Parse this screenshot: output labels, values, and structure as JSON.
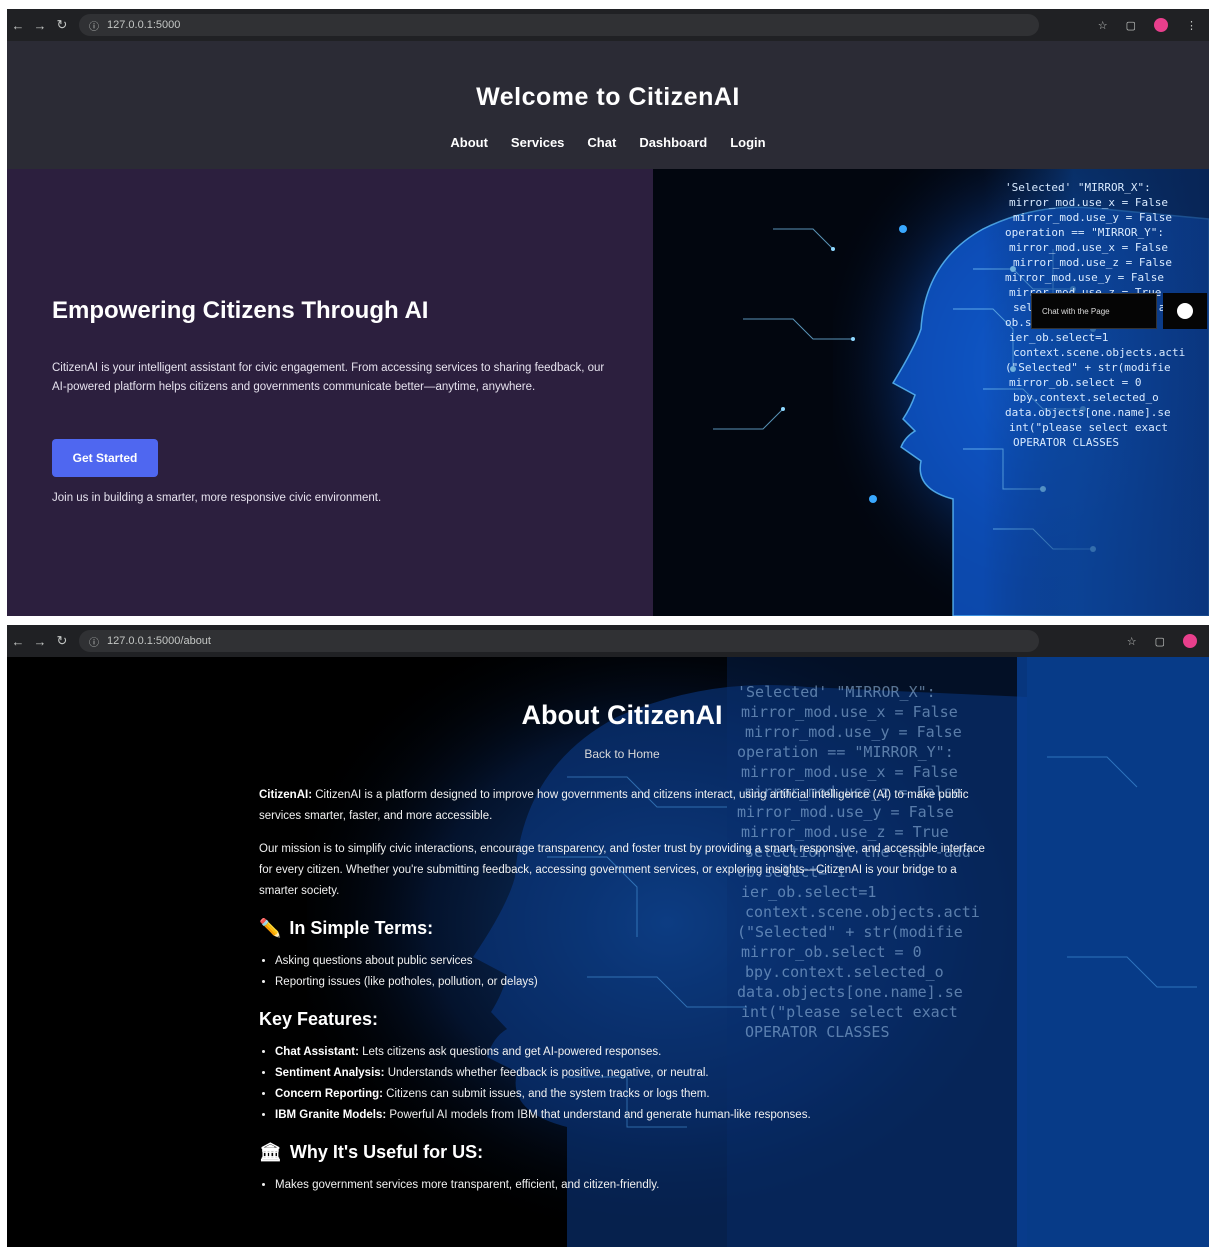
{
  "home": {
    "url": "127.0.0.1:5000",
    "header": {
      "title": "Welcome to CitizenAI",
      "nav": [
        "About",
        "Services",
        "Chat",
        "Dashboard",
        "Login"
      ]
    },
    "hero": {
      "heading": "Empowering Citizens Through AI",
      "text": "CitizenAI is your intelligent assistant for civic engagement. From accessing services to sharing feedback, our AI-powered platform helps citizens and governments communicate better—anytime, anywhere.",
      "button": "Get Started",
      "join": "Join us in building a smarter, more responsive civic environment."
    },
    "chat_widget": {
      "label": "Chat with the Page"
    },
    "code_lines": [
      "'Selected'  \"MIRROR_X\":",
      "mirror_mod.use_x = False",
      "mirror_mod.use_y = False",
      "operation == \"MIRROR_Y\":",
      "mirror_mod.use_x = False",
      "mirror_mod.use_z = False",
      "mirror_mod.use_y = False",
      "mirror_mod.use_z = True",
      "selection at the end -add",
      "  ob.select= 1",
      "ier_ob.select=1",
      "context.scene.objects.acti",
      "(\"Selected\" + str(modifie",
      "mirror_ob.select = 0",
      "  bpy.context.selected_o",
      "data.objects[one.name].se",
      "int(\"please select exact",
      "  OPERATOR CLASSES"
    ]
  },
  "about": {
    "url": "127.0.0.1:5000/about",
    "title": "About CitizenAI",
    "back_link": "Back to Home",
    "intro_label": "CitizenAI:",
    "intro_text": " CitizenAI is a platform designed to improve how governments and citizens interact, using artificial intelligence (AI) to make public services smarter, faster, and more accessible.",
    "mission": "Our mission is to simplify civic interactions, encourage transparency, and foster trust by providing a smart, responsive, and accessible interface for every citizen. Whether you're submitting feedback, accessing government services, or exploring insights—CitizenAI is your bridge to a smarter society.",
    "simple_terms": {
      "icon": "✏️",
      "heading": "In Simple Terms:",
      "items": [
        "Asking questions about public services",
        "Reporting issues (like potholes, pollution, or delays)"
      ]
    },
    "key_features": {
      "heading": "Key Features:",
      "items": [
        {
          "label": "Chat Assistant:",
          "text": " Lets citizens ask questions and get AI-powered responses."
        },
        {
          "label": "Sentiment Analysis:",
          "text": " Understands whether feedback is positive, negative, or neutral."
        },
        {
          "label": "Concern Reporting:",
          "text": " Citizens can submit issues, and the system tracks or logs them."
        },
        {
          "label": "IBM Granite Models:",
          "text": " Powerful AI models from IBM that understand and generate human-like responses."
        }
      ]
    },
    "why_useful": {
      "icon": "🏛",
      "heading": "Why It's Useful for US:",
      "items": [
        "Makes government services more transparent, efficient, and citizen-friendly."
      ]
    }
  },
  "colors": {
    "header_bg": "#2b2b35",
    "hero_bg": "#2c1f3e",
    "button": "#4f67f0",
    "accent_blue": "#1e90ff"
  }
}
